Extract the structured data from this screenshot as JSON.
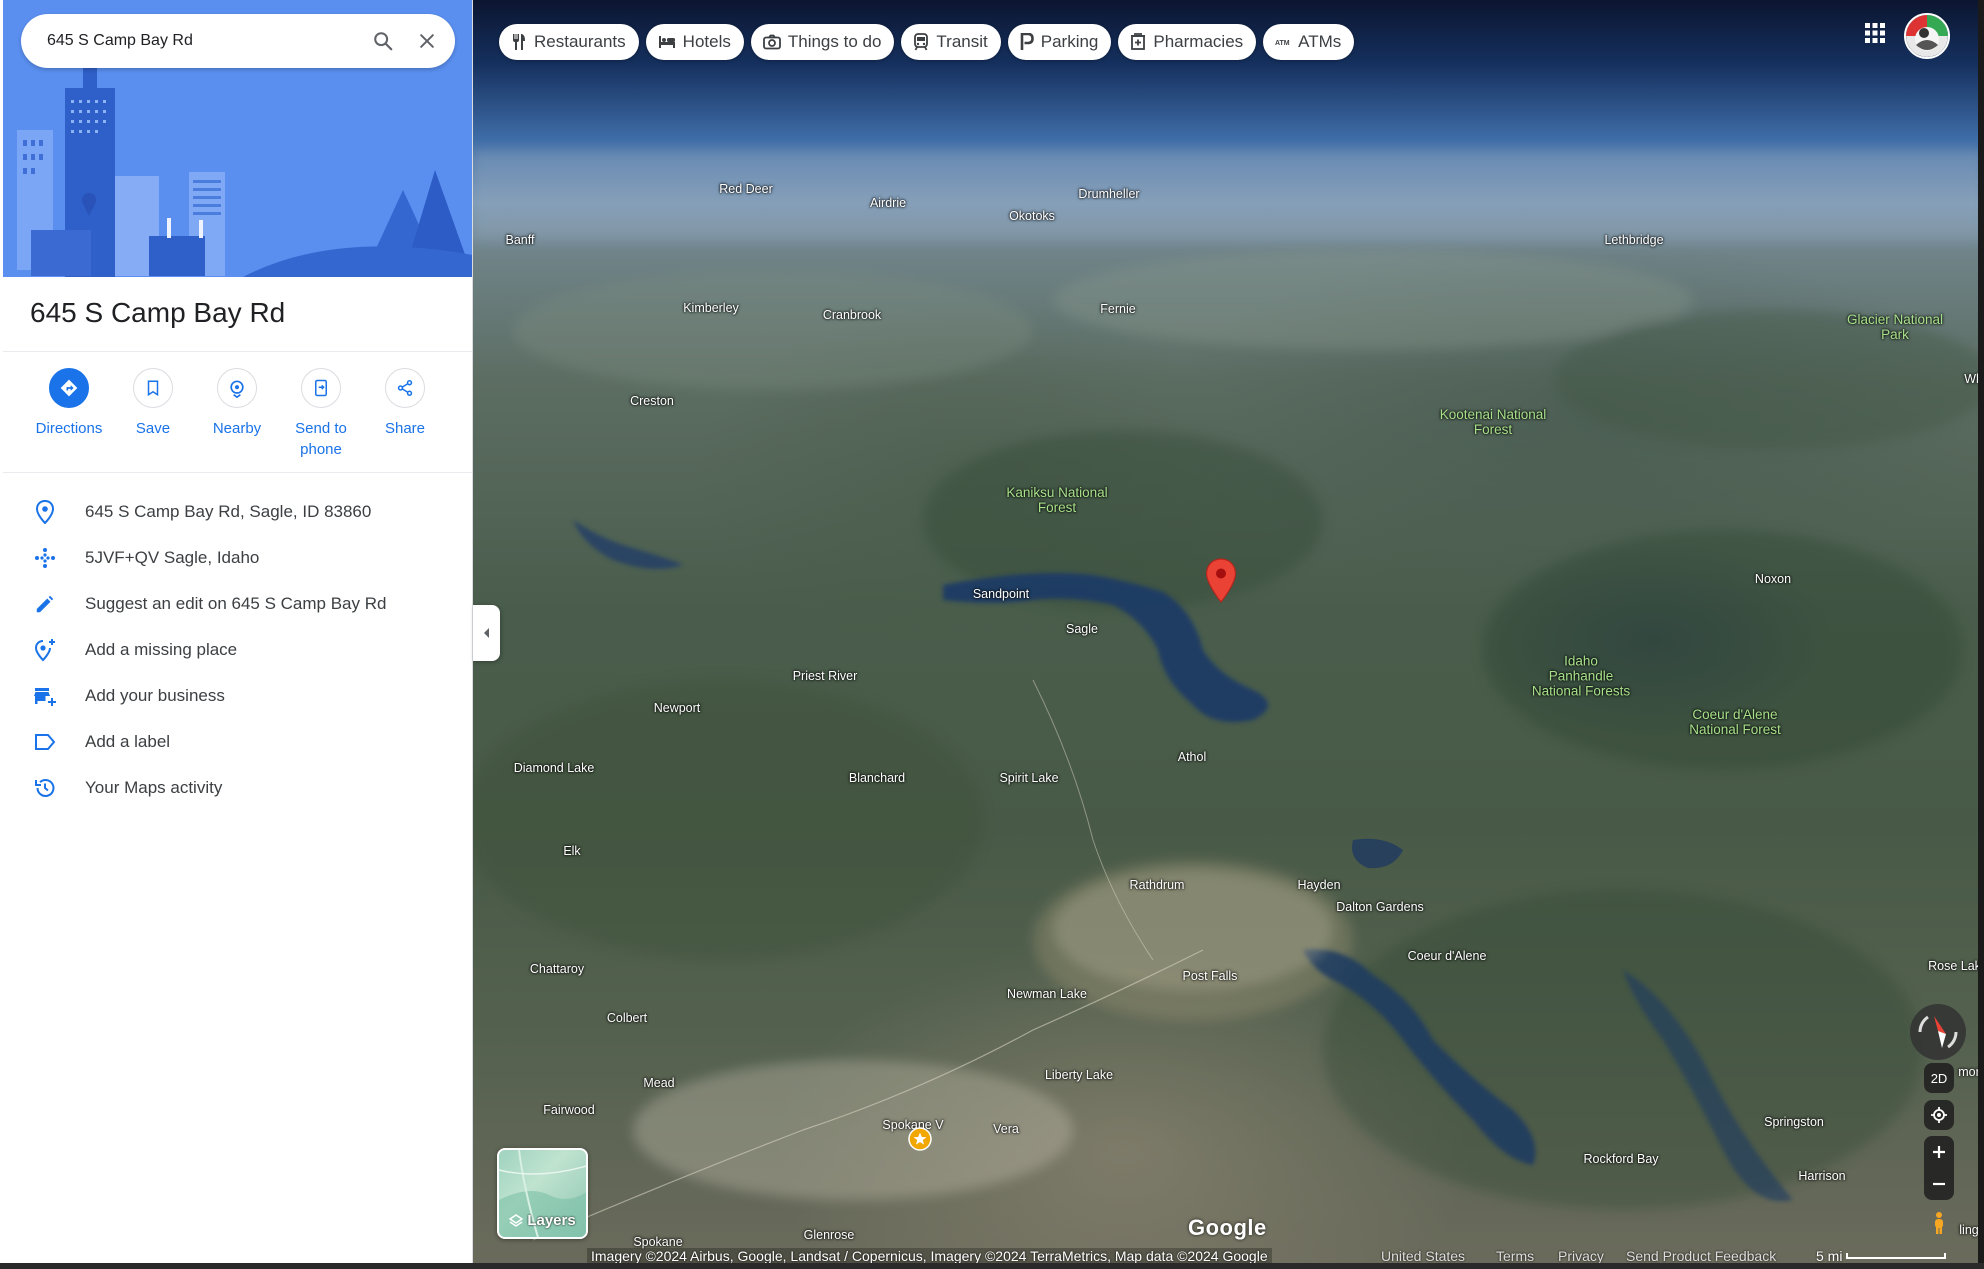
{
  "search": {
    "value": "645 S Camp Bay Rd",
    "search_icon": "search-icon",
    "close_icon": "close-icon"
  },
  "place": {
    "title": "645 S Camp Bay Rd"
  },
  "actions": [
    {
      "label": "Directions",
      "icon": "directions-icon"
    },
    {
      "label": "Save",
      "icon": "bookmark-icon"
    },
    {
      "label": "Nearby",
      "icon": "nearby-icon"
    },
    {
      "label": "Send to phone",
      "icon": "send-to-phone-icon"
    },
    {
      "label": "Share",
      "icon": "share-icon"
    }
  ],
  "info": [
    {
      "text": "645 S Camp Bay Rd, Sagle, ID 83860",
      "icon": "location-pin-icon"
    },
    {
      "text": "5JVF+QV Sagle, Idaho",
      "icon": "plus-code-icon"
    },
    {
      "text": "Suggest an edit on 645 S Camp Bay Rd",
      "icon": "pencil-icon"
    },
    {
      "text": "Add a missing place",
      "icon": "add-place-icon"
    },
    {
      "text": "Add your business",
      "icon": "add-business-icon"
    },
    {
      "text": "Add a label",
      "icon": "label-icon"
    },
    {
      "text": "Your Maps activity",
      "icon": "history-icon"
    }
  ],
  "chips": [
    {
      "label": "Restaurants",
      "icon": "restaurant-icon"
    },
    {
      "label": "Hotels",
      "icon": "hotel-icon"
    },
    {
      "label": "Things to do",
      "icon": "camera-icon"
    },
    {
      "label": "Transit",
      "icon": "transit-icon"
    },
    {
      "label": "Parking",
      "icon": "parking-icon"
    },
    {
      "label": "Pharmacies",
      "icon": "pharmacy-icon"
    },
    {
      "label": "ATMs",
      "icon": "atm-icon"
    }
  ],
  "map_labels": {
    "red_deer": "Red Deer",
    "airdrie": "Airdrie",
    "drumheller": "Drumheller",
    "okotoks": "Okotoks",
    "banff": "Banff",
    "lethbridge": "Lethbridge",
    "kimberley": "Kimberley",
    "cranbrook": "Cranbrook",
    "fernie": "Fernie",
    "glacier": "Glacier National Park",
    "whi": "Whi",
    "creston": "Creston",
    "kootenai": "Kootenai National Forest",
    "kaniksu": "Kaniksu National Forest",
    "sandpoint": "Sandpoint",
    "sagle": "Sagle",
    "noxon": "Noxon",
    "priest_river": "Priest River",
    "newport": "Newport",
    "idaho_panhandle": "Idaho Panhandle National Forests",
    "coeur_forest": "Coeur d'Alene National Forest",
    "diamond_lake": "Diamond Lake",
    "blanchard": "Blanchard",
    "spirit_lake": "Spirit Lake",
    "athol": "Athol",
    "elk": "Elk",
    "rathdrum": "Rathdrum",
    "hayden": "Hayden",
    "dalton": "Dalton Gardens",
    "coeur": "Coeur d'Alene",
    "rose_lake": "Rose Lake",
    "chattaroy": "Chattaroy",
    "post_falls": "Post Falls",
    "newman_lake": "Newman Lake",
    "colbert": "Colbert",
    "mead": "Mead",
    "liberty_lake": "Liberty Lake",
    "fairwood": "Fairwood",
    "spokane_v": "Spokane V",
    "vera": "Vera",
    "springston": "Springston",
    "rockford_bay": "Rockford Bay",
    "harrison": "Harrison",
    "mor": "mor",
    "spokane": "Spokane",
    "glenrose": "Glenrose",
    "ling": "ling"
  },
  "controls": {
    "mode_2d": "2D",
    "layers_label": "Layers",
    "google_logo": "Google"
  },
  "footer": {
    "attribution": "Imagery ©2024 Airbus, Google, Landsat / Copernicus, Imagery ©2024 TerraMetrics, Map data ©2024 Google",
    "country": "United States",
    "terms": "Terms",
    "privacy": "Privacy",
    "feedback": "Send Product Feedback",
    "scale": "5 mi"
  },
  "colors": {
    "accent": "#1a73e8",
    "pin": "#ea4335"
  }
}
